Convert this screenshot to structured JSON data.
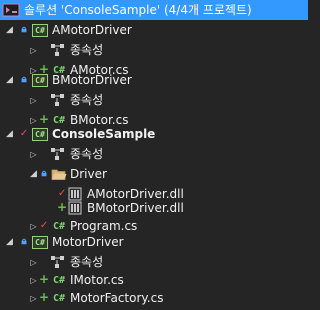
{
  "solution": {
    "label": "솔루션 'ConsoleSample' (4/4개 프로젝트)",
    "icon": "solution-icon"
  },
  "projects": [
    {
      "name": "AMotorDriver",
      "icon_text": "C#",
      "dependencies_label": "종속성",
      "files": [
        "AMotor.cs"
      ]
    },
    {
      "name": "BMotorDriver",
      "icon_text": "C#",
      "dependencies_label": "종속성",
      "files": [
        "BMotor.cs"
      ]
    },
    {
      "name": "ConsoleSample",
      "icon_text": "C#",
      "dependencies_label": "종속성",
      "folder": {
        "name": "Driver",
        "files": [
          "AMotorDriver.dll",
          "BMotorDriver.dll"
        ]
      },
      "files": [
        "Program.cs"
      ]
    },
    {
      "name": "MotorDriver",
      "icon_text": "C#",
      "dependencies_label": "종속성",
      "files": [
        "IMotor.cs",
        "MotorFactory.cs"
      ]
    }
  ],
  "file_icon_text": "C#",
  "colors": {
    "background": "#252526",
    "selection": "#3399ff",
    "text": "#f1f1f1",
    "lock": "#4da3ff",
    "checkmark": "#f14c4c",
    "plus": "#6cc04a"
  }
}
